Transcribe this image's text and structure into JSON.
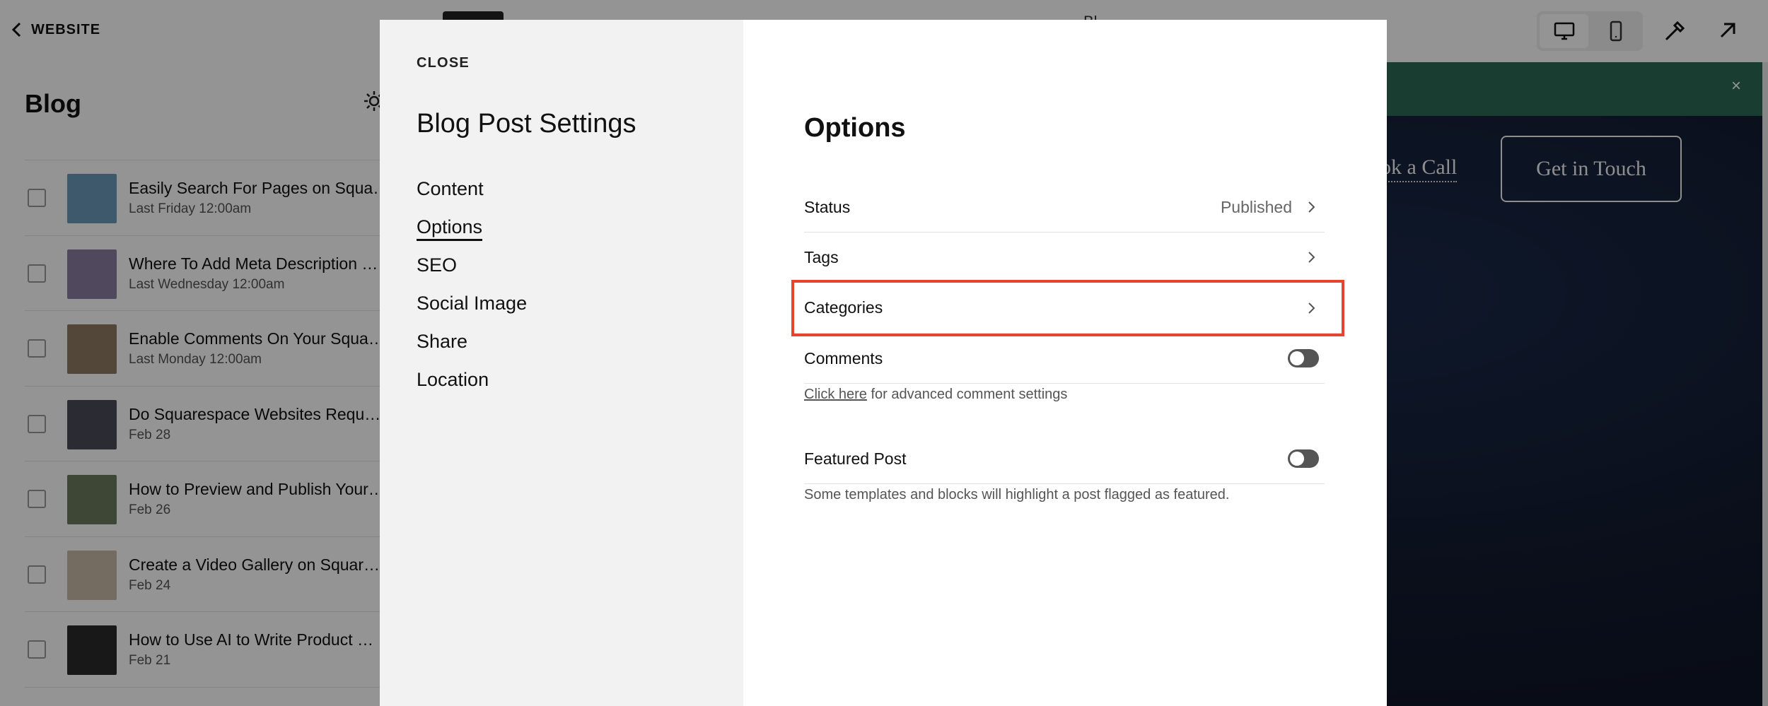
{
  "sidebar": {
    "back_label": "WEBSITE",
    "title": "Blog",
    "posts": [
      {
        "title": "Easily Search For Pages on Squa…",
        "date": "Last Friday 12:00am",
        "thumb_color": "#6b9ab8"
      },
      {
        "title": "Where To Add Meta Description …",
        "date": "Last Wednesday 12:00am",
        "thumb_color": "#8a7fa0"
      },
      {
        "title": "Enable Comments On Your Squa…",
        "date": "Last Monday 12:00am",
        "thumb_color": "#8d7a62"
      },
      {
        "title": "Do Squarespace Websites Requ…",
        "date": "Feb 28",
        "thumb_color": "#4a4a5a"
      },
      {
        "title": "How to Preview and Publish Your…",
        "date": "Feb 26",
        "thumb_color": "#6c7a5e"
      },
      {
        "title": "Create a Video Gallery on Squar…",
        "date": "Feb 24",
        "thumb_color": "#c9b8a8"
      },
      {
        "title": "How to Use AI to Write Product …",
        "date": "Feb 21",
        "thumb_color": "#2a2a2a"
      }
    ]
  },
  "preview": {
    "page_title": "Bl…",
    "hero_link": "ok a Call",
    "hero_button": "Get in Touch",
    "banner_close": "×"
  },
  "modal": {
    "close_label": "CLOSE",
    "title": "Blog Post Settings",
    "nav": [
      "Content",
      "Options",
      "SEO",
      "Social Image",
      "Share",
      "Location"
    ],
    "active_nav": "Options",
    "section_title": "Options",
    "status_label": "Status",
    "status_value": "Published",
    "tags_label": "Tags",
    "categories_label": "Categories",
    "comments_label": "Comments",
    "comments_helper_link": "Click here",
    "comments_helper_text": " for advanced comment settings",
    "featured_label": "Featured Post",
    "featured_helper": "Some templates and blocks will highlight a post flagged as featured."
  },
  "colors": {
    "highlight": "#e5452f",
    "banner": "#2c6a55"
  }
}
